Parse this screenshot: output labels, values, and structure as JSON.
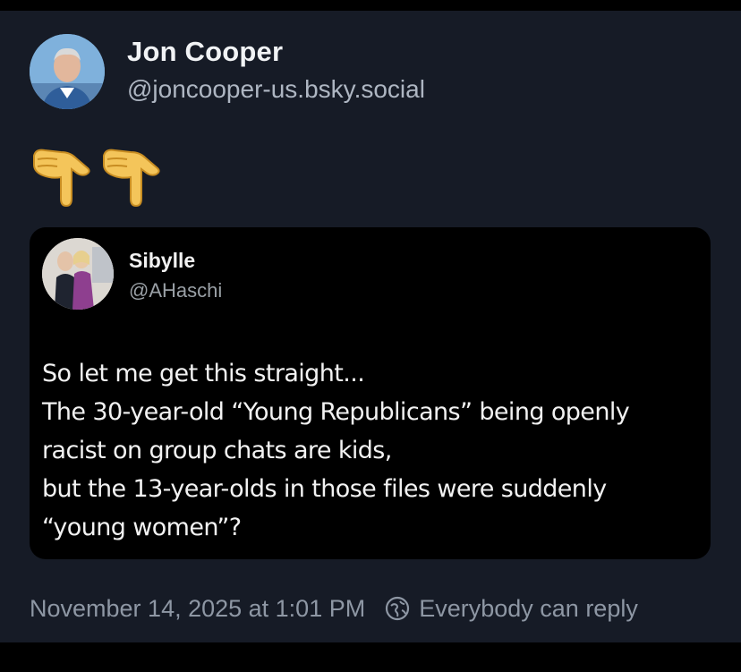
{
  "post": {
    "author": {
      "name": "Jon Cooper",
      "handle": "@joncooper-us.bsky.social",
      "avatar_icon": "person-photo-avatar"
    },
    "content_emoji": [
      "backhand-index-pointing-down",
      "backhand-index-pointing-down"
    ],
    "quote": {
      "author_name": "Sibylle",
      "author_handle": "@AHaschi",
      "avatar_icon": "person-photo-avatar",
      "lines": [
        "So let me get this straight...",
        "The 30-year-old “Young Republicans” being openly",
        "racist on group chats are kids,",
        "but the 13-year-olds in those files were suddenly",
        "“young women”?"
      ]
    },
    "timestamp": "November 14, 2025 at 1:01 PM",
    "reply_setting": "Everybody can reply",
    "reply_icon": "globe-reply-icon"
  },
  "colors": {
    "card_background": "#161b26",
    "quote_background": "#000000",
    "primary_text": "#f1f3f5",
    "secondary_text": "#aeb6c2",
    "meta_text": "#8e97a4"
  }
}
